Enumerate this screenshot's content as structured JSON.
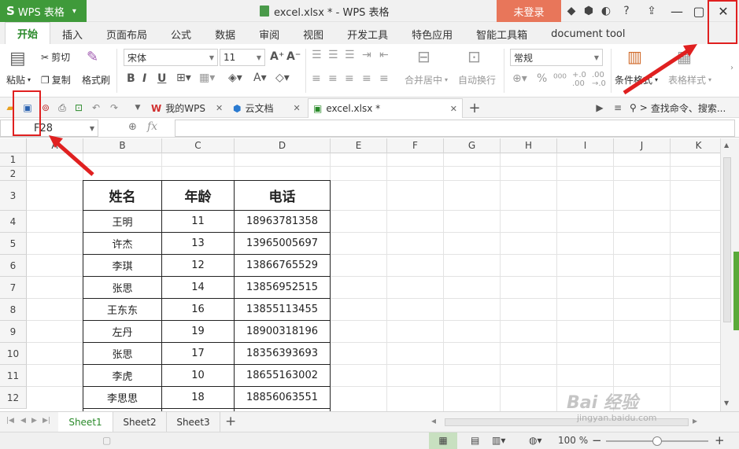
{
  "app": {
    "menu_label": "WPS 表格",
    "window_title": "excel.xlsx * - WPS 表格",
    "login_label": "未登录"
  },
  "ribbon_tabs": [
    "开始",
    "插入",
    "页面布局",
    "公式",
    "数据",
    "审阅",
    "视图",
    "开发工具",
    "特色应用",
    "智能工具箱",
    "document tool"
  ],
  "ribbon": {
    "cut": "剪切",
    "paste": "粘贴",
    "copy": "复制",
    "format_painter": "格式刷",
    "font_name": "宋体",
    "font_size": "11",
    "merge_center": "合并居中",
    "wrap_text": "自动换行",
    "number_format": "常规",
    "conditional_format": "条件格式",
    "table_style": "表格样式"
  },
  "doc_tabs": [
    {
      "label": "我的WPS"
    },
    {
      "label": "云文档"
    },
    {
      "label": "excel.xlsx *"
    }
  ],
  "search_cmd": "查找命令、搜索...",
  "name_box": "F28",
  "fx_label": "fx",
  "columns": [
    "A",
    "B",
    "C",
    "D",
    "E",
    "F",
    "G",
    "H",
    "I",
    "J",
    "K"
  ],
  "rows": [
    "1",
    "2",
    "3",
    "4",
    "5",
    "6",
    "7",
    "8",
    "9",
    "10",
    "11",
    "12"
  ],
  "table": {
    "headers": [
      "姓名",
      "年龄",
      "电话"
    ],
    "records": [
      [
        "王明",
        "11",
        "18963781358"
      ],
      [
        "许杰",
        "13",
        "13965005697"
      ],
      [
        "李琪",
        "12",
        "13866765529"
      ],
      [
        "张思",
        "14",
        "13856952515"
      ],
      [
        "王东东",
        "16",
        "13855113455"
      ],
      [
        "左丹",
        "19",
        "18900318196"
      ],
      [
        "张思",
        "17",
        "18356393693"
      ],
      [
        "李虎",
        "10",
        "18655163002"
      ],
      [
        "李思思",
        "18",
        "18856063551"
      ]
    ]
  },
  "sheets": [
    "Sheet1",
    "Sheet2",
    "Sheet3"
  ],
  "status": {
    "zoom": "100 %",
    "zoom_fraction": 0.5
  },
  "watermark": {
    "brand": "Bai 经验",
    "url": "jingyan.baidu.com"
  },
  "colors": {
    "brand_green": "#3f9a3a",
    "login_orange": "#e8765a",
    "annotation_red": "#e02020"
  }
}
